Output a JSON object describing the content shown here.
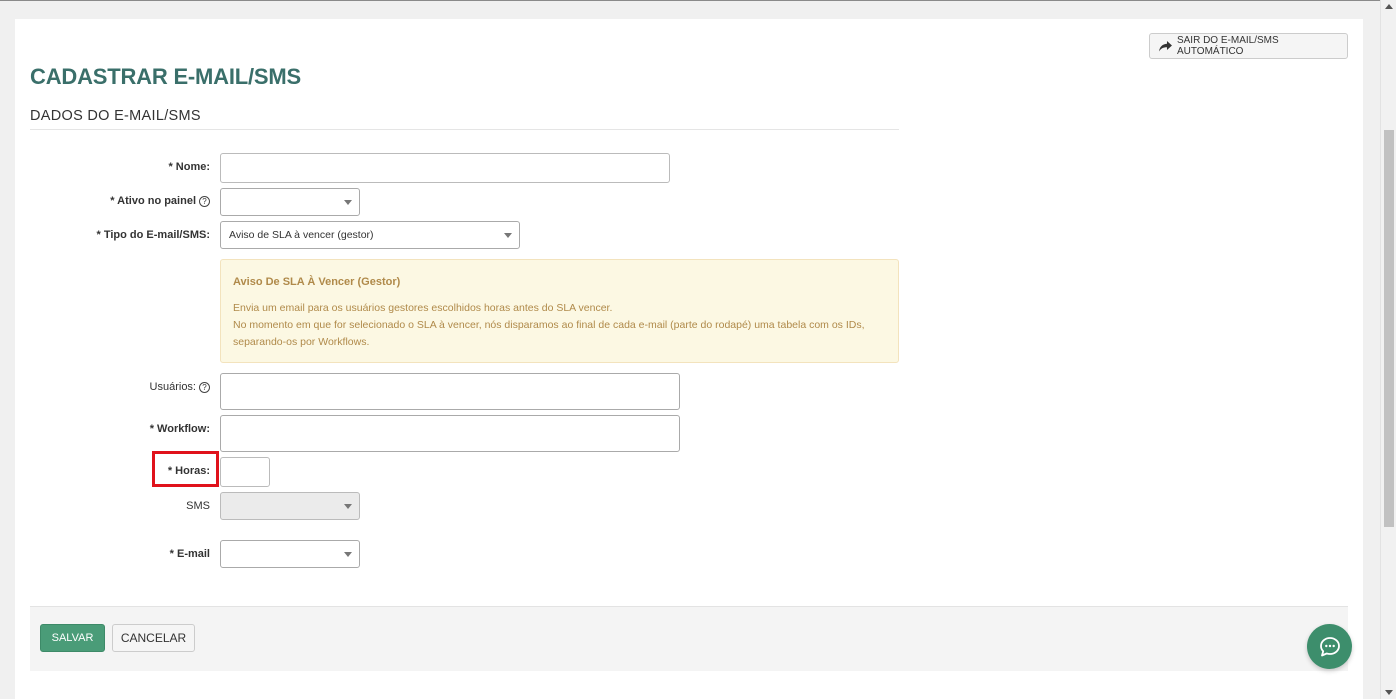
{
  "header": {
    "exit_button_label": "SAIR DO E-MAIL/SMS AUTOMÁTICO",
    "page_title": "CADASTRAR E-MAIL/SMS",
    "section_title": "DADOS DO E-MAIL/SMS"
  },
  "form": {
    "nome_label": "* Nome:",
    "nome_value": "",
    "ativo_label": "* Ativo no painel",
    "ativo_value": "",
    "tipo_label": "* Tipo do E-mail/SMS:",
    "tipo_value": "Aviso de SLA à vencer (gestor)",
    "usuarios_label": "Usuários:",
    "workflow_label": "* Workflow:",
    "horas_label": "* Horas:",
    "horas_value": "",
    "sms_label": "SMS",
    "sms_value": "",
    "email_label": "* E-mail",
    "email_value": "",
    "help_icon_glyph": "?"
  },
  "alert": {
    "title": "Aviso De SLA À Vencer (Gestor)",
    "line1": "Envia um email para os usuários gestores escolhidos horas antes do SLA vencer.",
    "line2": "No momento em que for selecionado o SLA à vencer, nós disparamos ao final de cada e-mail (parte do rodapé) uma tabela com os IDs, separando-os por Workflows."
  },
  "footer": {
    "save_label": "SALVAR",
    "cancel_label": "CANCELAR"
  },
  "colors": {
    "title": "#3a6f6a",
    "save_button": "#4a9c78",
    "highlight": "#e0121b",
    "chat_button": "#3d8e6c",
    "alert_bg": "#fcf8e3",
    "alert_text": "#b08a4a"
  },
  "icons": {
    "exit": "share-arrow-icon",
    "help": "question-circle-icon",
    "chat": "chat-bubble-icon"
  }
}
